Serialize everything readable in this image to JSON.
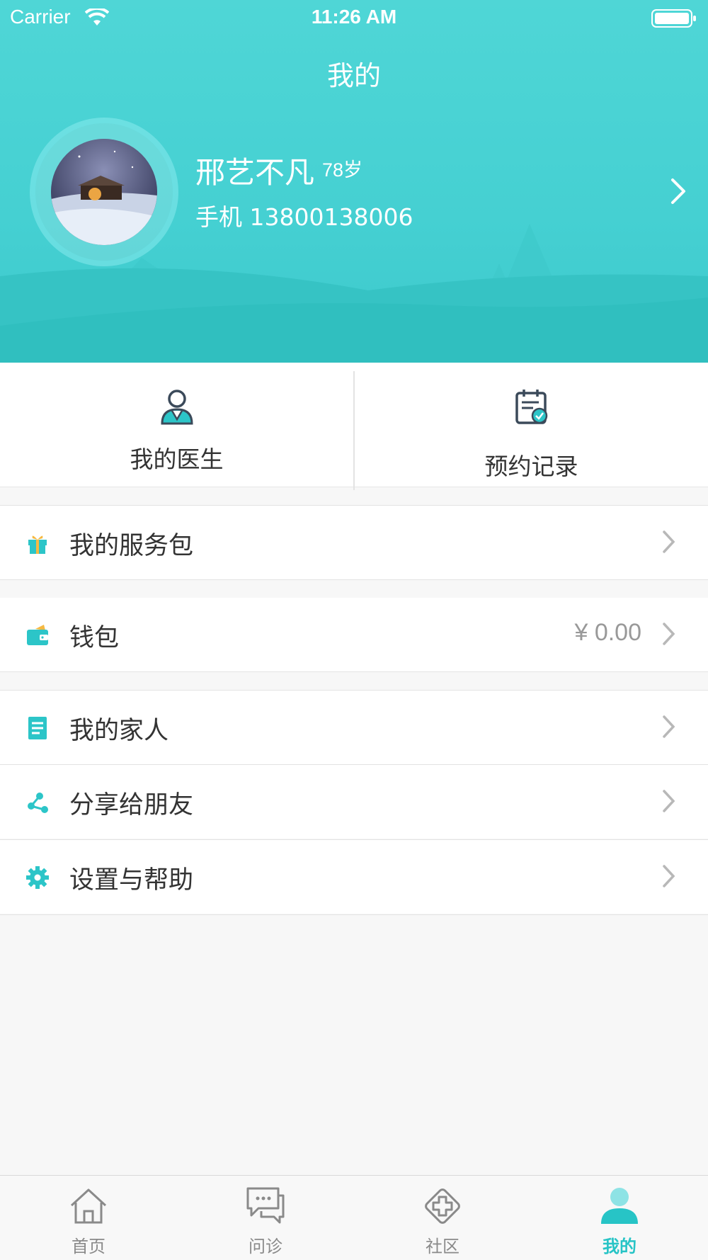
{
  "status_bar": {
    "carrier": "Carrier",
    "time": "11:26 AM"
  },
  "header": {
    "title": "我的"
  },
  "profile": {
    "name": "邢艺不凡",
    "age": "78岁",
    "phone": "手机 13800138006"
  },
  "quick_actions": [
    {
      "label": "我的医生",
      "icon": "doctor-icon"
    },
    {
      "label": "预约记录",
      "icon": "appointment-calendar-icon"
    }
  ],
  "menu": {
    "service_package": {
      "label": "我的服务包",
      "icon": "gift-icon"
    },
    "wallet": {
      "label": "钱包",
      "value": "¥ 0.00",
      "icon": "wallet-icon"
    },
    "family": {
      "label": "我的家人",
      "icon": "document-icon"
    },
    "share": {
      "label": "分享给朋友",
      "icon": "share-icon"
    },
    "settings": {
      "label": "设置与帮助",
      "icon": "gear-icon"
    }
  },
  "tabbar": [
    {
      "label": "首页",
      "icon": "home-icon"
    },
    {
      "label": "问诊",
      "icon": "chat-icon"
    },
    {
      "label": "社区",
      "icon": "medical-cross-icon"
    },
    {
      "label": "我的",
      "icon": "person-icon",
      "active": true
    }
  ],
  "colors": {
    "accent": "#27c4c6",
    "hero": "#4ad3d5"
  }
}
